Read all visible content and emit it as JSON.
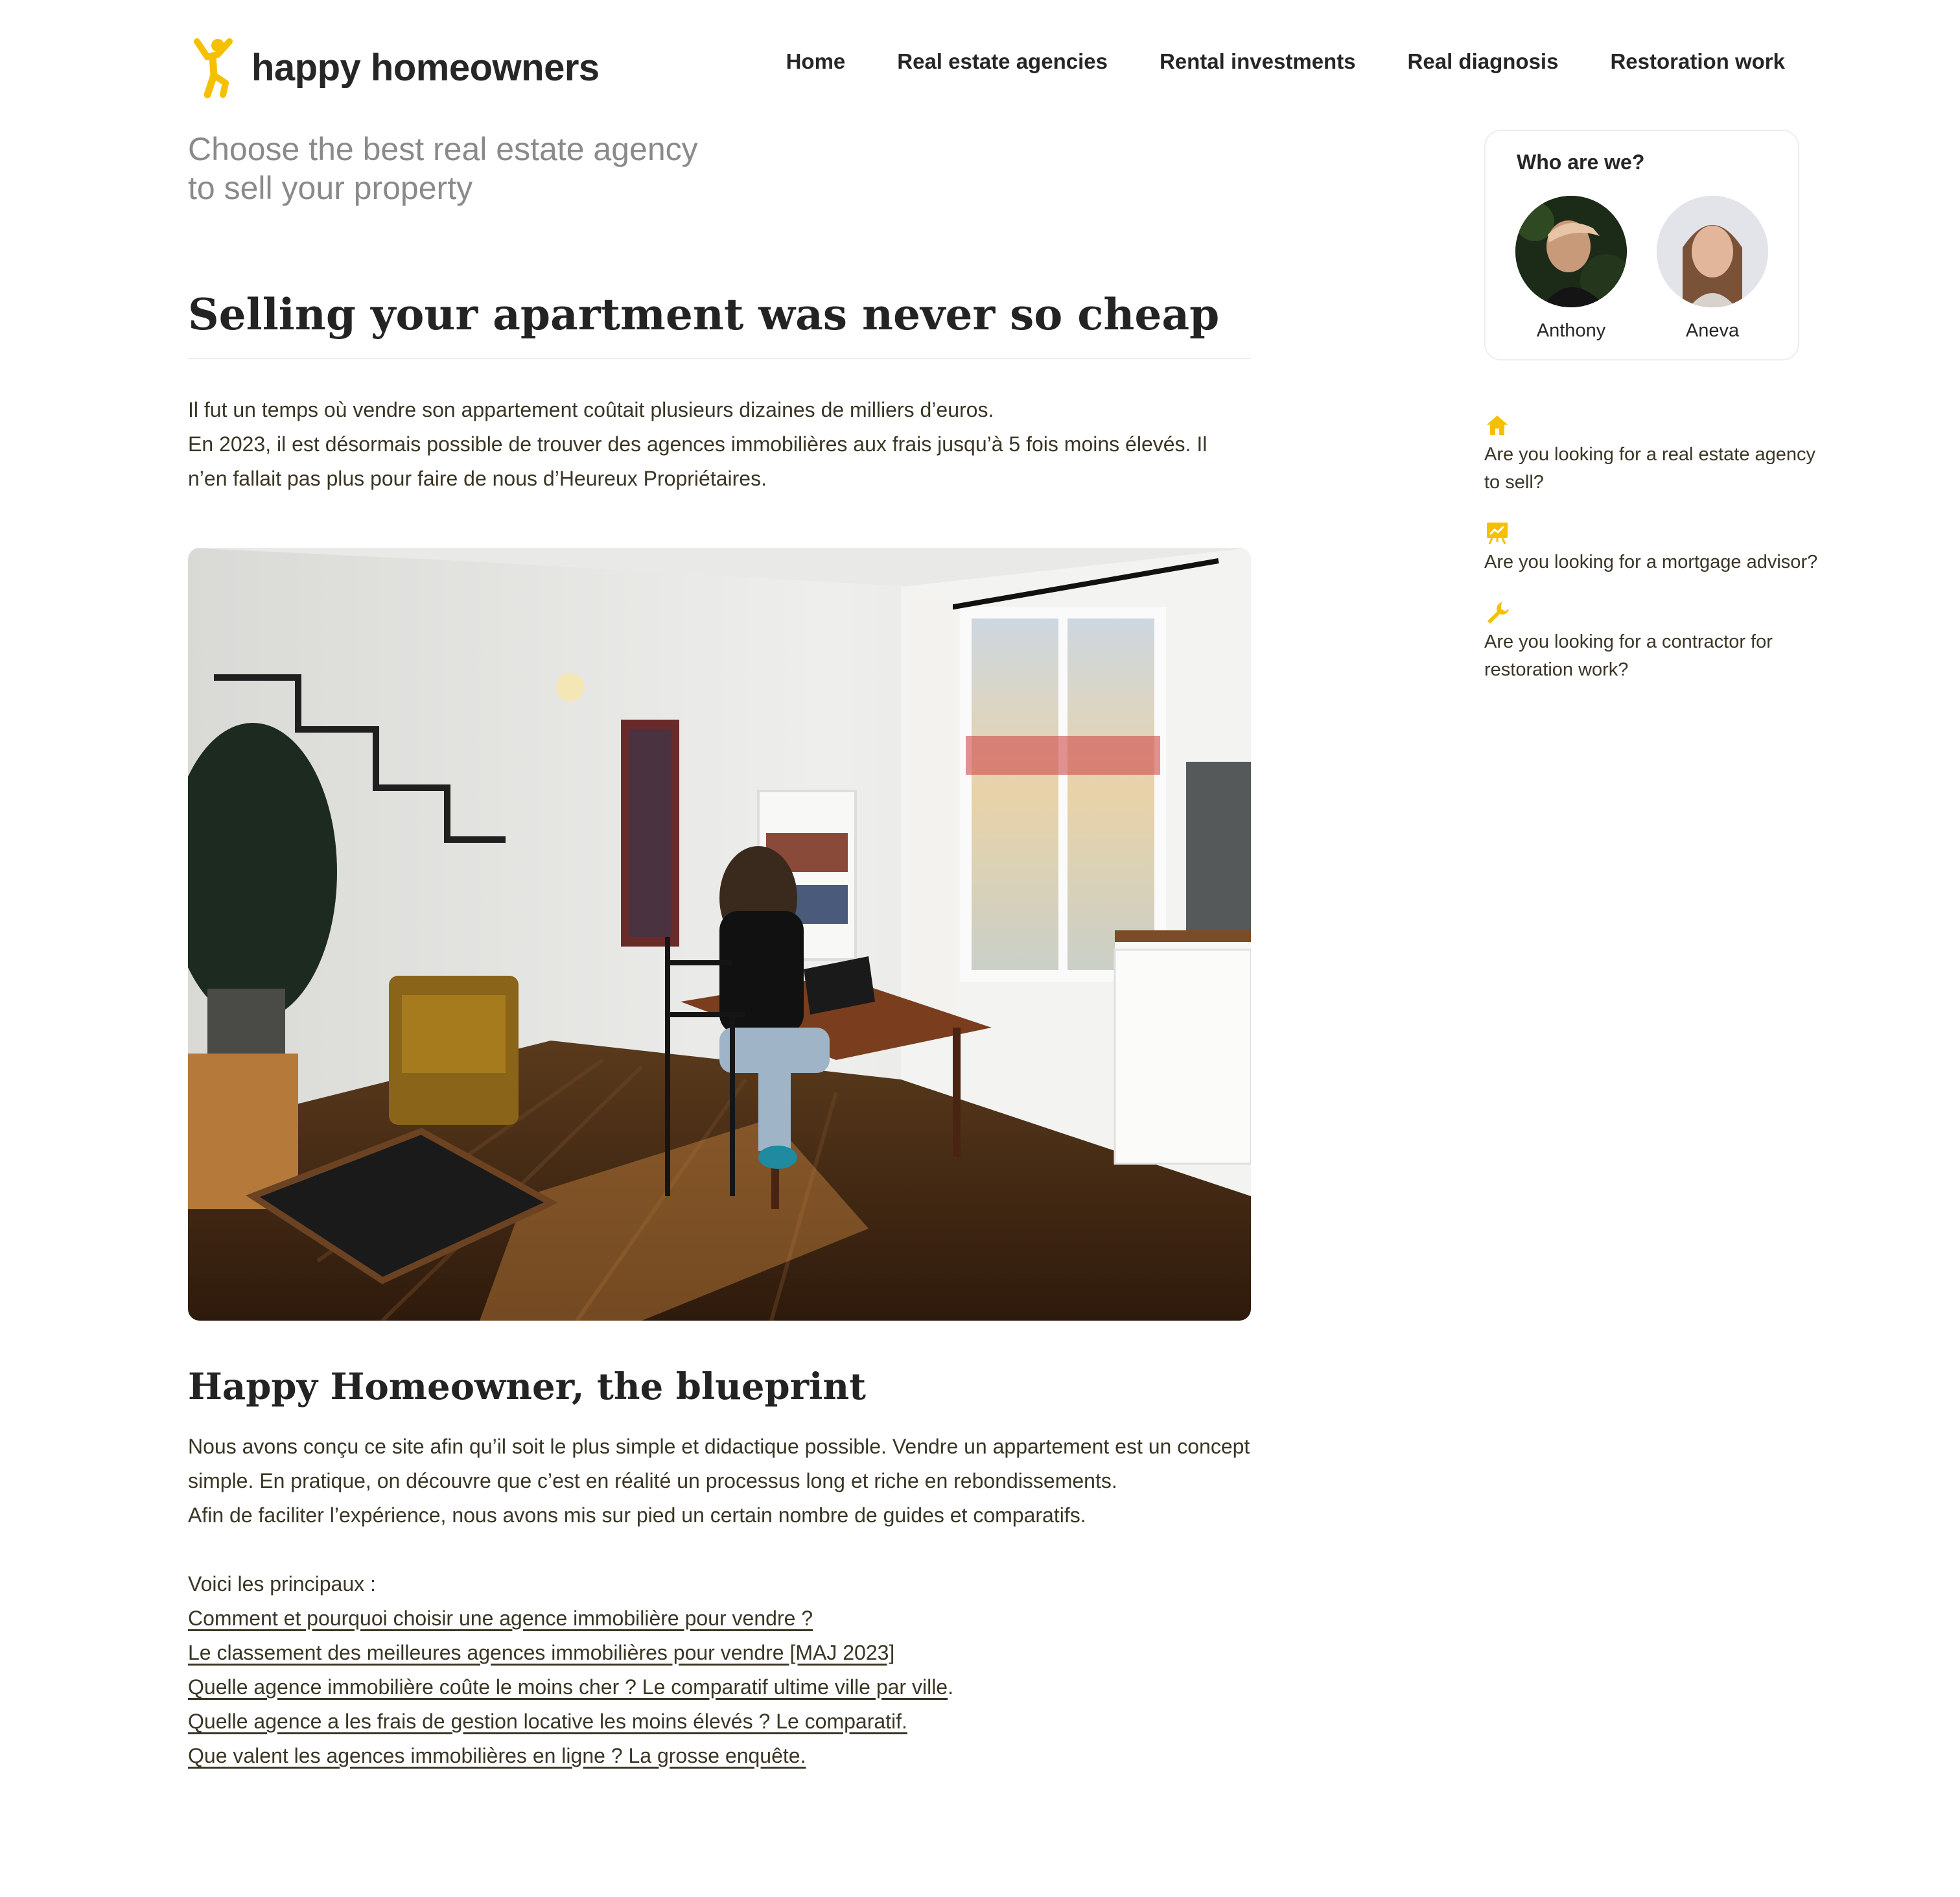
{
  "brand": {
    "name": "happy homeowners",
    "accent": "#f5c000"
  },
  "nav": {
    "items": [
      {
        "label": "Home"
      },
      {
        "label": "Real estate agencies"
      },
      {
        "label": "Rental investments"
      },
      {
        "label": "Real diagnosis"
      },
      {
        "label": "Restoration work"
      }
    ]
  },
  "tagline": {
    "line1": "Choose the best real estate agency",
    "line2": "to sell your property"
  },
  "article": {
    "title": "Selling your apartment was never so cheap",
    "intro": [
      "Il fut un temps où vendre son appartement coûtait plusieurs dizaines de milliers d’euros.",
      "En 2023, il est désormais possible de trouver des agences immobilières aux frais jusqu’à 5 fois moins élevés. Il n’en fallait pas plus pour faire de nous d’Heureux Propriétaires."
    ],
    "section_title": "Happy Homeowner, the blueprint",
    "section_body": [
      "Nous avons conçu ce site afin qu’il soit le plus simple et didactique possible. Vendre un appartement est un concept simple. En pratique, on découvre que c’est en réalité un processus long et riche en rebondissements.",
      "Afin de faciliter l’expérience, nous avons mis sur pied un certain nombre de guides et comparatifs."
    ],
    "links_intro": "Voici les principaux :",
    "links": [
      {
        "label": "Comment et pourquoi choisir une agence immobilière pour vendre ?",
        "suffix": ""
      },
      {
        "label": "Le classement des meilleures agences immobilières pour vendre [MAJ 2023]",
        "suffix": ""
      },
      {
        "label": "Quelle agence immobilière coûte le moins cher ? Le comparatif ultime ville par ville",
        "suffix": "."
      },
      {
        "label": "Quelle agence a les frais de gestion locative les moins élevés ? Le comparatif.",
        "suffix": ""
      },
      {
        "label": "Que valent les agences immobilières en ligne ? La grosse enquête.",
        "suffix": ""
      }
    ]
  },
  "who": {
    "title": "Who are we?",
    "people": [
      {
        "name": "Anthony"
      },
      {
        "name": "Aneva"
      }
    ]
  },
  "quick_links": [
    {
      "icon": "house-icon",
      "label": "Are you looking for a real estate agency to sell?"
    },
    {
      "icon": "chart-board-icon",
      "label": "Are you looking for a mortgage advisor?"
    },
    {
      "icon": "wrench-icon",
      "label": "Are you looking for a contractor for restoration work?"
    }
  ]
}
